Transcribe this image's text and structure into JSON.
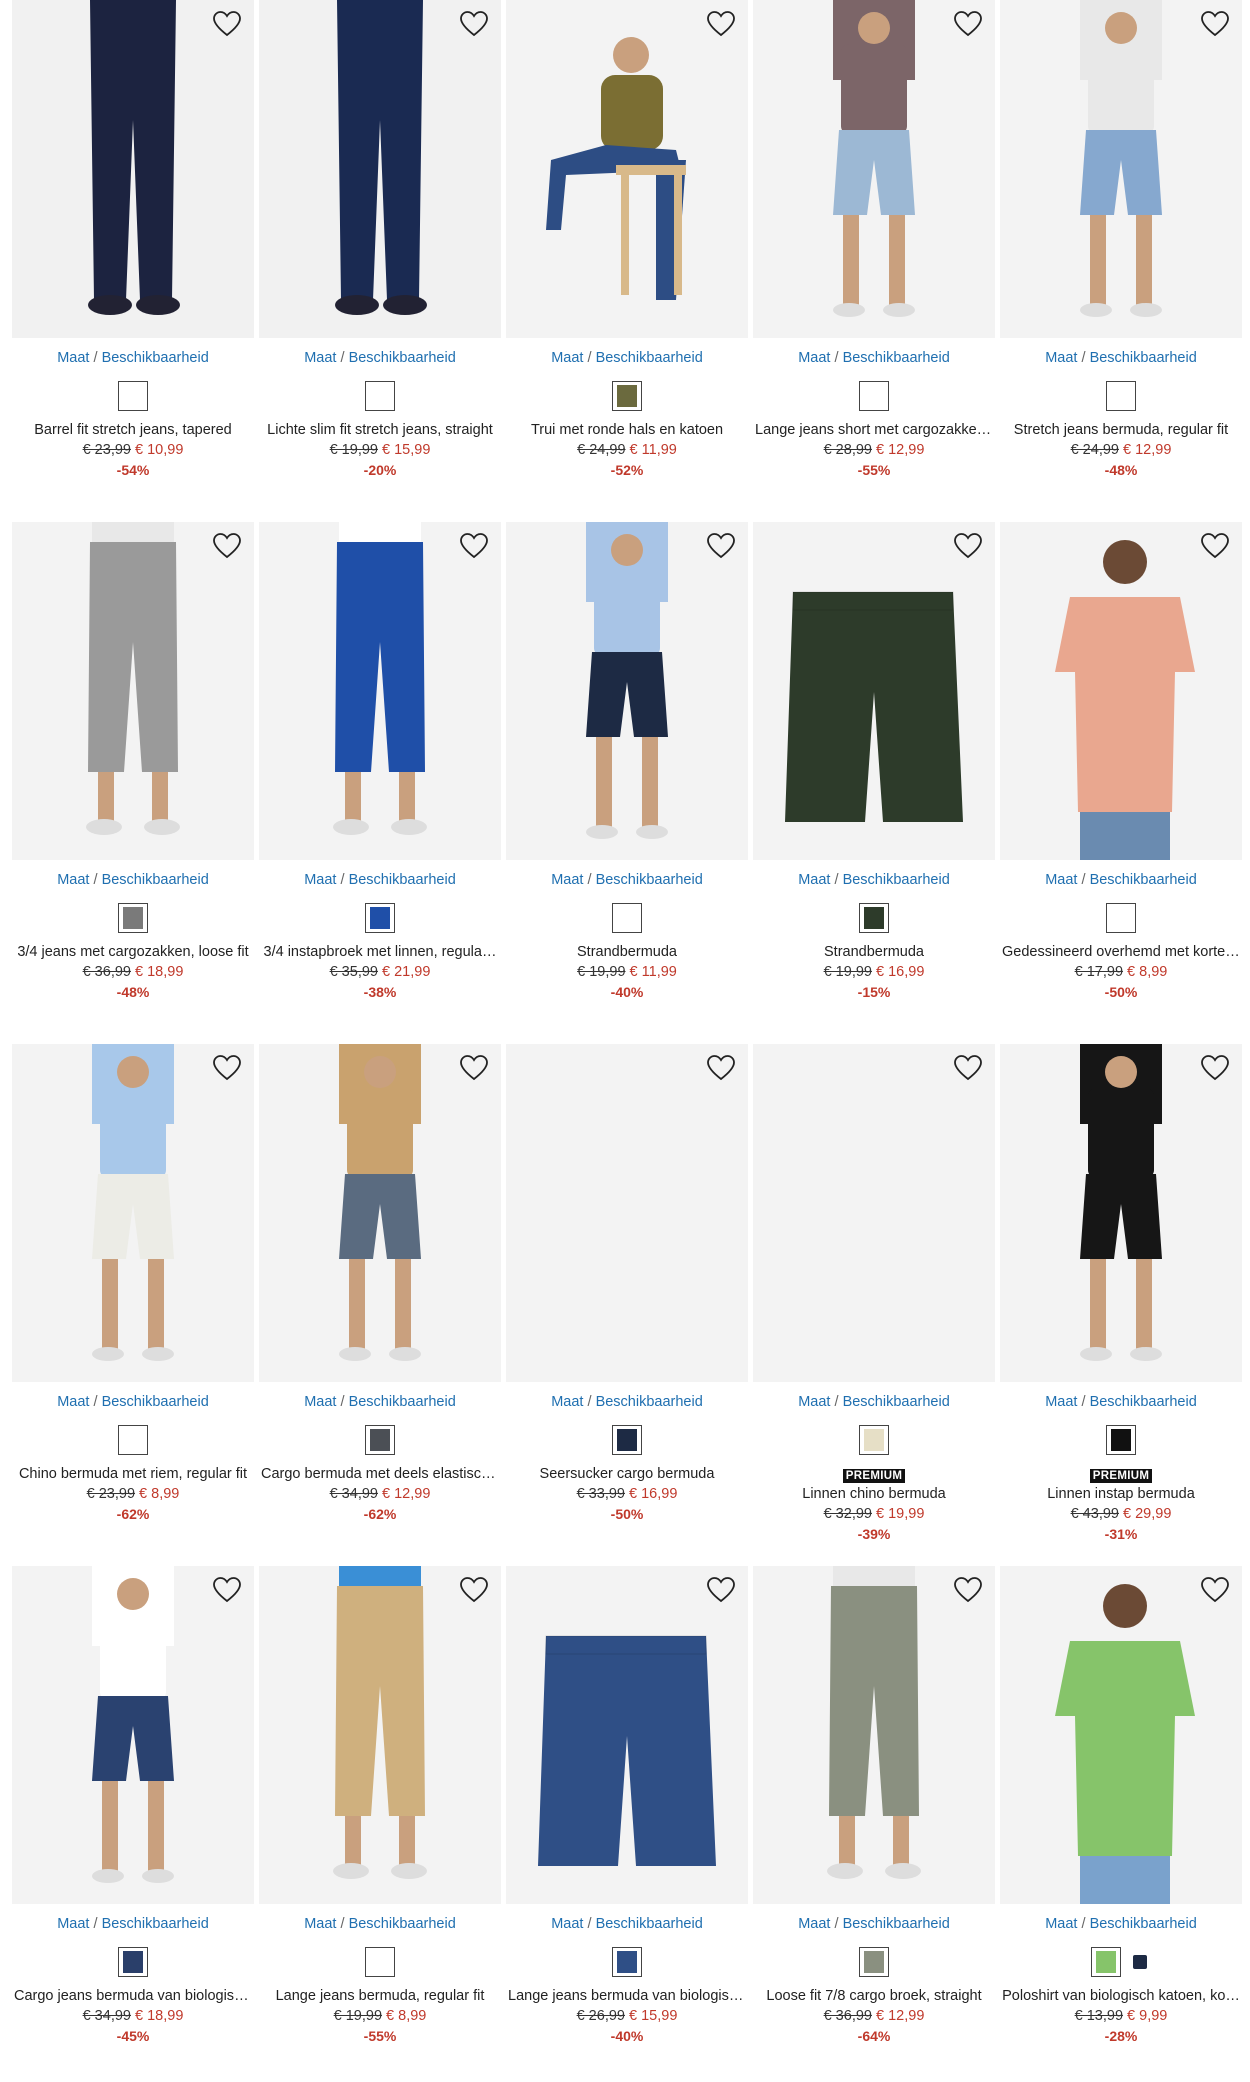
{
  "link_maat": "Maat",
  "link_sep": " / ",
  "link_beschikbaarheid": "Beschikbaarheid",
  "premium_label": "PREMIUM",
  "colors": {
    "link": "#1f6fb0",
    "sale": "#c0392b",
    "premium_bg": "#111111"
  },
  "products": [
    {
      "title": "Barrel fit stretch jeans, tapered",
      "old_price": "€ 23,99",
      "new_price": "€ 10,99",
      "discount": "-54%",
      "swatches": [
        "plain"
      ],
      "premium": false
    },
    {
      "title": "Lichte slim fit stretch jeans, straight",
      "old_price": "€ 19,99",
      "new_price": "€ 15,99",
      "discount": "-20%",
      "swatches": [
        "plain"
      ],
      "premium": false
    },
    {
      "title": "Trui met ronde hals en katoen",
      "old_price": "€ 24,99",
      "new_price": "€ 11,99",
      "discount": "-52%",
      "swatches": [
        "#6b6a3e"
      ],
      "premium": false
    },
    {
      "title": "Lange jeans short met cargozakken…",
      "old_price": "€ 28,99",
      "new_price": "€ 12,99",
      "discount": "-55%",
      "swatches": [
        "plain"
      ],
      "premium": false
    },
    {
      "title": "Stretch jeans bermuda, regular fit",
      "old_price": "€ 24,99",
      "new_price": "€ 12,99",
      "discount": "-48%",
      "swatches": [
        "plain"
      ],
      "premium": false
    },
    {
      "title": "3/4 jeans met cargozakken, loose fit",
      "old_price": "€ 36,99",
      "new_price": "€ 18,99",
      "discount": "-48%",
      "swatches": [
        "#7a7a7a"
      ],
      "premium": false
    },
    {
      "title": "3/4 instapbroek met linnen, regula…",
      "old_price": "€ 35,99",
      "new_price": "€ 21,99",
      "discount": "-38%",
      "swatches": [
        "#1f4fa8"
      ],
      "premium": false
    },
    {
      "title": "Strandbermuda",
      "old_price": "€ 19,99",
      "new_price": "€ 11,99",
      "discount": "-40%",
      "swatches": [
        "plain"
      ],
      "premium": false
    },
    {
      "title": "Strandbermuda",
      "old_price": "€ 19,99",
      "new_price": "€ 16,99",
      "discount": "-15%",
      "swatches": [
        "#2d3b2a"
      ],
      "premium": false
    },
    {
      "title": "Gedessineerd overhemd met korte …",
      "old_price": "€ 17,99",
      "new_price": "€ 8,99",
      "discount": "-50%",
      "swatches": [
        "plain"
      ],
      "premium": false
    },
    {
      "title": "Chino bermuda met riem, regular fit",
      "old_price": "€ 23,99",
      "new_price": "€ 8,99",
      "discount": "-62%",
      "swatches": [
        "plain"
      ],
      "premium": false
    },
    {
      "title": "Cargo bermuda met deels elastisch…",
      "old_price": "€ 34,99",
      "new_price": "€ 12,99",
      "discount": "-62%",
      "swatches": [
        "#4b4f55"
      ],
      "premium": false
    },
    {
      "title": "Seersucker cargo bermuda",
      "old_price": "€ 33,99",
      "new_price": "€ 16,99",
      "discount": "-50%",
      "swatches": [
        "#1d2a44"
      ],
      "premium": false
    },
    {
      "title": "Linnen chino bermuda",
      "old_price": "€ 32,99",
      "new_price": "€ 19,99",
      "discount": "-39%",
      "swatches": [
        "#e6dfc6"
      ],
      "premium": true
    },
    {
      "title": "Linnen instap bermuda",
      "old_price": "€ 43,99",
      "new_price": "€ 29,99",
      "discount": "-31%",
      "swatches": [
        "#111111"
      ],
      "premium": true
    },
    {
      "title": "Cargo jeans bermuda van biologisch…",
      "old_price": "€ 34,99",
      "new_price": "€ 18,99",
      "discount": "-45%",
      "swatches": [
        "#2a3f6a"
      ],
      "premium": false
    },
    {
      "title": "Lange jeans bermuda, regular fit",
      "old_price": "€ 19,99",
      "new_price": "€ 8,99",
      "discount": "-55%",
      "swatches": [
        "plain"
      ],
      "premium": false
    },
    {
      "title": "Lange jeans bermuda van biologisch…",
      "old_price": "€ 26,99",
      "new_price": "€ 15,99",
      "discount": "-40%",
      "swatches": [
        "#2f4f86"
      ],
      "premium": false
    },
    {
      "title": "Loose fit 7/8 cargo broek, straight",
      "old_price": "€ 36,99",
      "new_price": "€ 12,99",
      "discount": "-64%",
      "swatches": [
        "#8a9080"
      ],
      "premium": false
    },
    {
      "title": "Poloshirt van biologisch katoen, ko…",
      "old_price": "€ 13,99",
      "new_price": "€ 9,99",
      "discount": "-28%",
      "swatches": [
        "#86c46a",
        "#1d2a44"
      ],
      "premium": false
    }
  ]
}
